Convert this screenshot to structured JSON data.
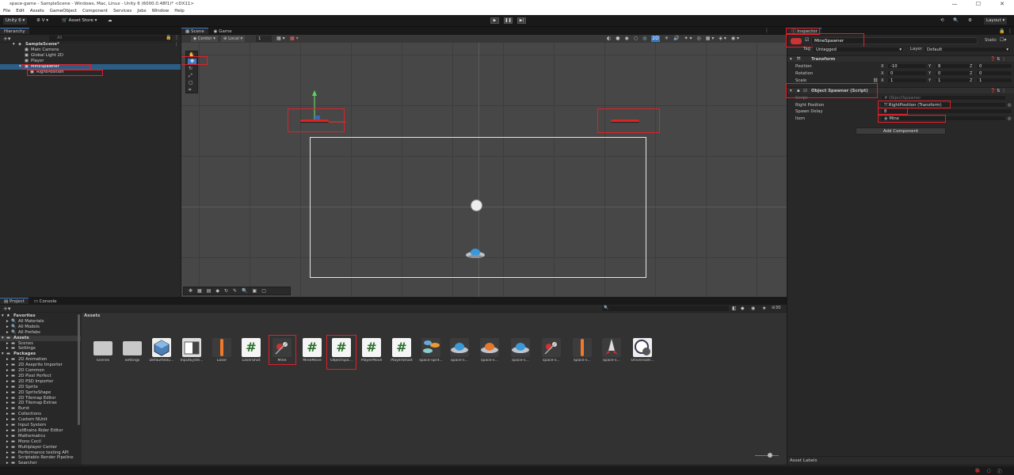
{
  "window": {
    "title": "space-game - SampleScene - Windows, Mac, Linux - Unity 6 (6000.0.48f1)* <DX11>",
    "controls": [
      "—",
      "☐",
      "✕"
    ]
  },
  "menu": [
    "File",
    "Edit",
    "Assets",
    "GameObject",
    "Component",
    "Services",
    "Jobs",
    "Window",
    "Help"
  ],
  "toolbar": {
    "account": "Unity 6",
    "version_ctl": "V",
    "asset_store": "Asset Store",
    "layout": "Layout"
  },
  "hierarchy": {
    "tab": "Hierarchy",
    "search_placeholder": "All",
    "items": [
      {
        "label": "SampleScene*",
        "depth": 0
      },
      {
        "label": "Main Camera",
        "depth": 1
      },
      {
        "label": "Global Light 2D",
        "depth": 1
      },
      {
        "label": "Player",
        "depth": 1
      },
      {
        "label": "MineSpawner",
        "depth": 1
      },
      {
        "label": "RightPosition",
        "depth": 2
      }
    ]
  },
  "scene": {
    "tabs": [
      "Scene",
      "Game"
    ],
    "pivot": "Center",
    "space": "Local",
    "grid_size": "1"
  },
  "inspector": {
    "tab": "Inspector",
    "object_name": "MineSpawner",
    "static_label": "Static",
    "tag_label": "Tag",
    "tag_value": "Untagged",
    "layer_label": "Layer",
    "layer_value": "Default",
    "transform": {
      "title": "Transform",
      "rows": [
        {
          "label": "Position",
          "x": "-10",
          "y": "8",
          "z": "0"
        },
        {
          "label": "Rotation",
          "x": "0",
          "y": "0",
          "z": "0"
        },
        {
          "label": "Scale",
          "x": "1",
          "y": "1",
          "z": "1"
        }
      ]
    },
    "script": {
      "title": "Object Spawner (Script)",
      "script_label": "Script",
      "script_value": "ObjectSpawner",
      "right_position_label": "Right Position",
      "right_position_value": "RightPosition (Transform)",
      "spawn_delay_label": "Spawn Delay",
      "spawn_delay_value": "8",
      "item_label": "Item",
      "item_value": "Mine"
    },
    "add_component": "Add Component",
    "asset_labels": "Asset Labels"
  },
  "project": {
    "tabs": [
      "Project",
      "Console"
    ],
    "breadcrumb": "Assets",
    "count": "30",
    "tree": [
      {
        "label": "Favorites",
        "depth": 0,
        "bold": true
      },
      {
        "label": "All Materials",
        "depth": 1
      },
      {
        "label": "All Models",
        "depth": 1
      },
      {
        "label": "All Prefabs",
        "depth": 1
      },
      {
        "label": "Assets",
        "depth": 0,
        "bold": true
      },
      {
        "label": "Scenes",
        "depth": 1
      },
      {
        "label": "Settings",
        "depth": 1
      },
      {
        "label": "Packages",
        "depth": 0,
        "bold": true
      },
      {
        "label": "2D Animation",
        "depth": 1
      },
      {
        "label": "2D Aseprite Importer",
        "depth": 1
      },
      {
        "label": "2D Common",
        "depth": 1
      },
      {
        "label": "2D Pixel Perfect",
        "depth": 1
      },
      {
        "label": "2D PSD Importer",
        "depth": 1
      },
      {
        "label": "2D Sprite",
        "depth": 1
      },
      {
        "label": "2D SpriteShape",
        "depth": 1
      },
      {
        "label": "2D Tilemap Editor",
        "depth": 1
      },
      {
        "label": "2D Tilemap Extras",
        "depth": 1
      },
      {
        "label": "Burst",
        "depth": 1
      },
      {
        "label": "Collections",
        "depth": 1
      },
      {
        "label": "Custom NUnit",
        "depth": 1
      },
      {
        "label": "Input System",
        "depth": 1
      },
      {
        "label": "JetBrains Rider Editor",
        "depth": 1
      },
      {
        "label": "Mathematics",
        "depth": 1
      },
      {
        "label": "Mono Cecil",
        "depth": 1
      },
      {
        "label": "Multiplayer Center",
        "depth": 1
      },
      {
        "label": "Performance testing API",
        "depth": 1
      },
      {
        "label": "Scriptable Render Pipeline",
        "depth": 1
      },
      {
        "label": "Searcher",
        "depth": 1
      }
    ],
    "assets": [
      {
        "label": "Scenes",
        "kind": "folder"
      },
      {
        "label": "Settings",
        "kind": "folder"
      },
      {
        "label": "DefaultVolu...",
        "kind": "cube"
      },
      {
        "label": "InputSyste...",
        "kind": "input"
      },
      {
        "label": "Laser",
        "kind": "laser"
      },
      {
        "label": "LaserShot",
        "kind": "script"
      },
      {
        "label": "Mine",
        "kind": "mine"
      },
      {
        "label": "MineMove",
        "kind": "script"
      },
      {
        "label": "ObjectSpa...",
        "kind": "script"
      },
      {
        "label": "PlayerMove",
        "kind": "script"
      },
      {
        "label": "PlayerShoot",
        "kind": "script"
      },
      {
        "label": "space-sprit...",
        "kind": "sheet"
      },
      {
        "label": "space-s...",
        "kind": "ufo"
      },
      {
        "label": "space-s...",
        "kind": "ufo-orange"
      },
      {
        "label": "space-s...",
        "kind": "ufo"
      },
      {
        "label": "space-s...",
        "kind": "mine"
      },
      {
        "label": "space-s...",
        "kind": "laser"
      },
      {
        "label": "space-s...",
        "kind": "rocket"
      },
      {
        "label": "UniversalR...",
        "kind": "settings"
      }
    ]
  },
  "colors": {
    "selection": "#2c5d87",
    "highlight": "#e0202a",
    "accent": "#3a79c2"
  }
}
